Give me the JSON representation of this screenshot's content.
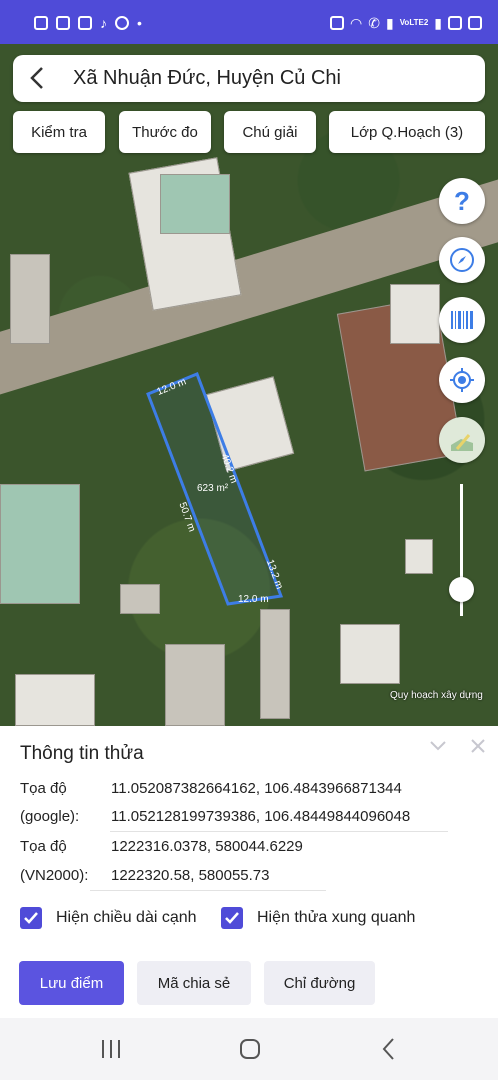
{
  "status_bar": {
    "left_icons": [
      "sim-icon",
      "notification-icon",
      "image-icon",
      "tiktok-icon",
      "facebook-icon",
      "dot-icon"
    ],
    "right_icons": [
      "alarm-icon",
      "wifi-icon",
      "call-icon",
      "signal-icon",
      "volte-icon",
      "signal2-icon",
      "battery-saver-icon",
      "battery-icon"
    ],
    "volte_text": "VoLTE2"
  },
  "search": {
    "title": "Xã Nhuận Đức, Huyện Củ Chi"
  },
  "toolbar": {
    "kiem_tra": "Kiểm tra",
    "thuoc_do": "Thước đo",
    "chu_giai": "Chú giải",
    "lop_qhoach": "Lớp Q.Hoạch (3)"
  },
  "map": {
    "parcel_area": "623 m²",
    "edge_top": "12.0 m",
    "edge_left": "50.7 m",
    "edge_right_upper": "40.2 m",
    "edge_right_lower": "13.2 m",
    "edge_bottom": "12.0 m",
    "layer_label": "Quy hoạch xây dựng",
    "parcel_color": "#3d7de6",
    "zoom_level": 0.2
  },
  "panel": {
    "title": "Thông tin thửa",
    "coord_label": "Tọa độ",
    "coord_value": "11.052087382664162, 106.4843966871344",
    "google_label": "(google):",
    "google_value": "11.052128199739386, 106.48449844096048",
    "vn_label": "Tọa độ",
    "vn_value": "1222316.0378, 580044.6229",
    "vn2000_label": "(VN2000):",
    "vn2000_value": "1222320.58, 580055.73",
    "show_edge_label": "Hiện chiều dài cạnh",
    "show_neighbors_label": "Hiện thửa xung quanh",
    "save_point": "Lưu điểm",
    "share_code": "Mã chia sẻ",
    "directions": "Chỉ đường",
    "accent": "#4f4bd8"
  }
}
